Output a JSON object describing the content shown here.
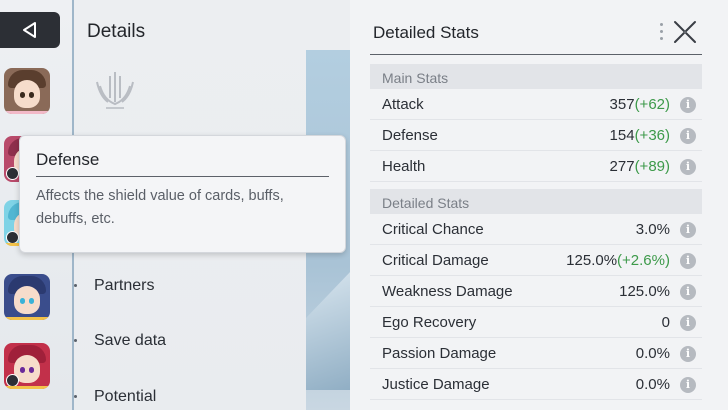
{
  "details": {
    "title": "Details",
    "menu": [
      {
        "label": "Partners"
      },
      {
        "label": "Save data"
      },
      {
        "label": "Potential"
      }
    ]
  },
  "tooltip": {
    "title": "Defense",
    "body": "Affects the shield value of cards, buffs, debuffs, etc."
  },
  "stats": {
    "title": "Detailed Stats",
    "main_section": "Main Stats",
    "detail_section": "Detailed Stats",
    "main": [
      {
        "label": "Attack",
        "value": "357",
        "bonus": "(+62)"
      },
      {
        "label": "Defense",
        "value": "154",
        "bonus": "(+36)"
      },
      {
        "label": "Health",
        "value": "277",
        "bonus": "(+89)"
      }
    ],
    "detailed": [
      {
        "label": "Critical Chance",
        "value": "3.0%",
        "bonus": ""
      },
      {
        "label": "Critical Damage",
        "value": "125.0%",
        "bonus": "(+2.6%)"
      },
      {
        "label": "Weakness Damage",
        "value": "125.0%",
        "bonus": ""
      },
      {
        "label": "Ego Recovery",
        "value": "0",
        "bonus": ""
      },
      {
        "label": "Passion Damage",
        "value": "0.0%",
        "bonus": ""
      },
      {
        "label": "Justice Damage",
        "value": "0.0%",
        "bonus": ""
      }
    ],
    "info_glyph": "i"
  },
  "colors": {
    "bonus_green": "#3d9a4a",
    "back_button": "#2c2f35"
  },
  "icons": {
    "back": "back-triangle-icon",
    "close": "close-x-icon",
    "info": "info-icon",
    "emblem": "faction-emblem-icon"
  }
}
